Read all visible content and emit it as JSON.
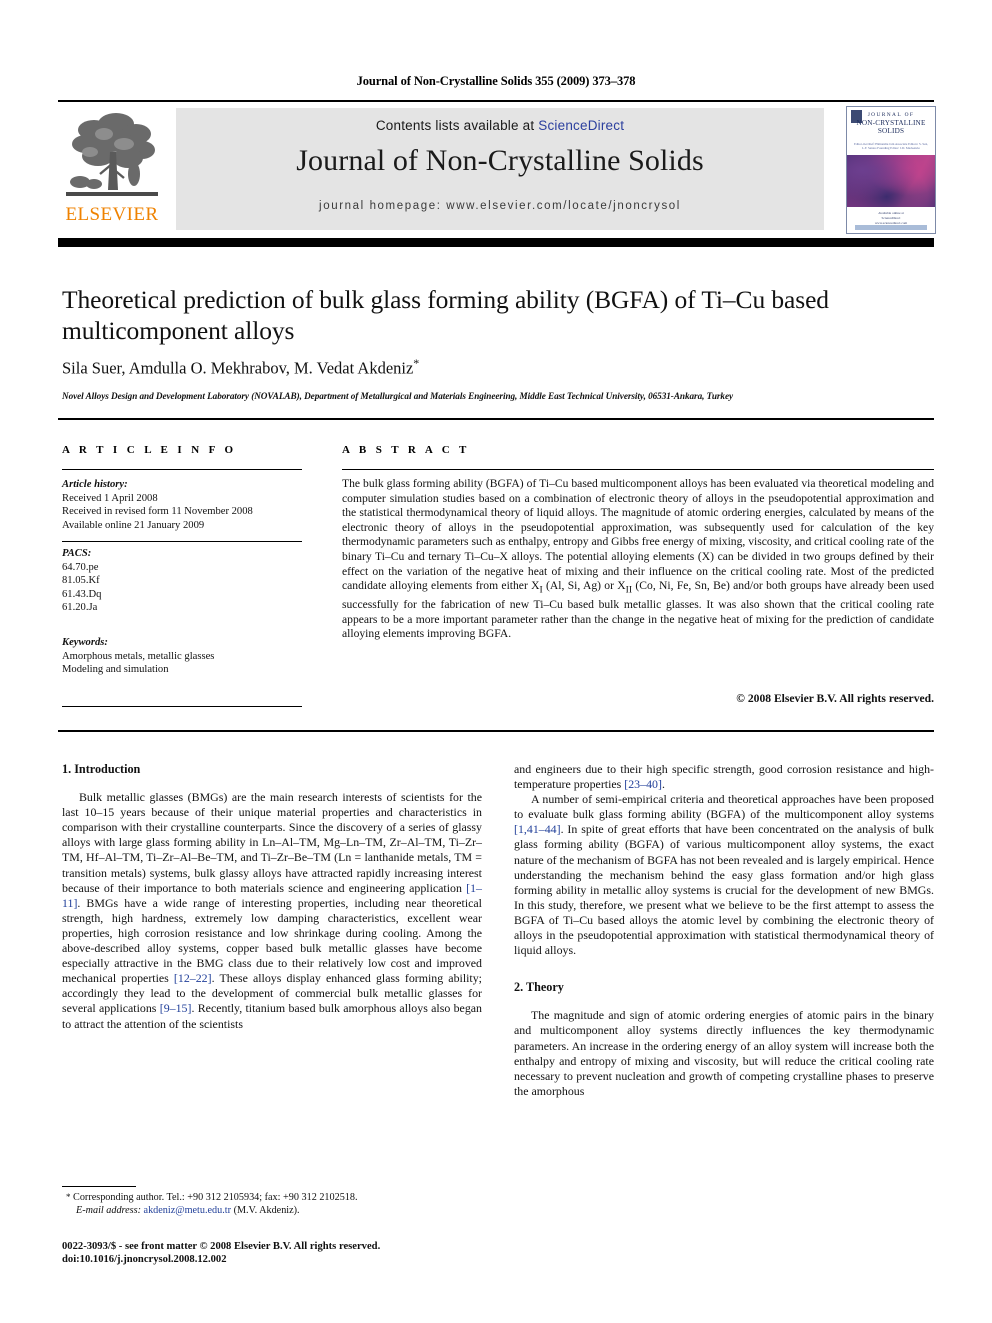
{
  "running_head": "Journal of Non-Crystalline Solids 355 (2009) 373–378",
  "masthead": {
    "publisher_name": "ELSEVIER",
    "contents_prefix": "Contents lists available at ",
    "contents_link": "ScienceDirect",
    "journal_title": "Journal of Non-Crystalline Solids",
    "homepage": "journal homepage: www.elsevier.com/locate/jnoncrysol",
    "cover": {
      "line1": "JOURNAL OF",
      "line2": "NON-CRYSTALLINE SOLIDS",
      "subline": "Editor-in-Chief: Himanshu Jain   Associate Editors: S. Sen, L.F. Santos   Founding Editor: J.D. Mackenzie",
      "footer": "Available online at\nScienceDirect\nwww.sciencedirect.com"
    }
  },
  "article": {
    "title": "Theoretical prediction of bulk glass forming ability (BGFA) of Ti–Cu based multicomponent alloys",
    "authors": "Sila Suer, Amdulla O. Mekhrabov, M. Vedat Akdeniz",
    "corresponding_marker": "*",
    "affiliation": "Novel Alloys Design and Development Laboratory (NOVALAB), Department of Metallurgical and Materials Engineering, Middle East Technical University, 06531-Ankara, Turkey"
  },
  "article_info": {
    "heading": "A R T I C L E   I N F O",
    "history_label": "Article history:",
    "history": [
      "Received 1 April 2008",
      "Received in revised form 11 November 2008",
      "Available online 21 January 2009"
    ],
    "pacs_label": "PACS:",
    "pacs": [
      "64.70.pe",
      "81.05.Kf",
      "61.43.Dq",
      "61.20.Ja"
    ],
    "keywords_label": "Keywords:",
    "keywords": [
      "Amorphous metals, metallic glasses",
      "Modeling and simulation"
    ]
  },
  "abstract": {
    "heading": "A B S T R A C T",
    "text": "The bulk glass forming ability (BGFA) of Ti–Cu based multicomponent alloys has been evaluated via theoretical modeling and computer simulation studies based on a combination of electronic theory of alloys in the pseudopotential approximation and the statistical thermodynamical theory of liquid alloys. The magnitude of atomic ordering energies, calculated by means of the electronic theory of alloys in the pseudopotential approximation, was subsequently used for calculation of the key thermodynamic parameters such as enthalpy, entropy and Gibbs free energy of mixing, viscosity, and critical cooling rate of the binary Ti–Cu and ternary Ti–Cu–X alloys. The potential alloying elements (X) can be divided in two groups defined by their effect on the variation of the negative heat of mixing and their influence on the critical cooling rate. Most of the predicted candidate alloying elements from either XI (Al, Si, Ag) or XII (Co, Ni, Fe, Sn, Be) and/or both groups have already been used successfully for the fabrication of new Ti–Cu based bulk metallic glasses. It was also shown that the critical cooling rate appears to be a more important parameter rather than the change in the negative heat of mixing for the prediction of candidate alloying elements improving BGFA.",
    "copyright": "© 2008 Elsevier B.V. All rights reserved."
  },
  "body": {
    "section1_heading": "1. Introduction",
    "section1_para1": "Bulk metallic glasses (BMGs) are the main research interests of scientists for the last 10–15 years because of their unique material properties and characteristics in comparison with their crystalline counterparts. Since the discovery of a series of glassy alloys with large glass forming ability in Ln–Al–TM, Mg–Ln–TM, Zr–Al–TM, Ti–Zr–TM, Hf–Al–TM, Ti–Zr–Al–Be–TM, and Ti–Zr–Be–TM (Ln = lanthanide metals, TM = transition metals) systems, bulk glassy alloys have attracted rapidly increasing interest because of their importance to both materials science and engineering application [1–11]. BMGs have a wide range of interesting properties, including near theoretical strength, high hardness, extremely low damping characteristics, excellent wear properties, high corrosion resistance and low shrinkage during cooling. Among the above-described alloy systems, copper based bulk metallic glasses have become especially attractive in the BMG class due to their relatively low cost and improved mechanical properties [12–22]. These alloys display enhanced glass forming ability; accordingly they lead to the development of commercial bulk metallic glasses for several applications [9–15]. Recently, titanium based bulk amorphous alloys also began to attract the attention of the scientists",
    "section1_para1_cont": "and engineers due to their high specific strength, good corrosion resistance and high-temperature properties [23–40].",
    "section1_para2": "A number of semi-empirical criteria and theoretical approaches have been proposed to evaluate bulk glass forming ability (BGFA) of the multicomponent alloy systems [1,41–44]. In spite of great efforts that have been concentrated on the analysis of bulk glass forming ability (BGFA) of various multicomponent alloy systems, the exact nature of the mechanism of BGFA has not been revealed and is largely empirical. Hence understanding the mechanism behind the easy glass formation and/or high glass forming ability in metallic alloy systems is crucial for the development of new BMGs. In this study, therefore, we present what we believe to be the first attempt to assess the BGFA of Ti–Cu based alloys the atomic level by combining the electronic theory of alloys in the pseudopotential approximation with statistical thermodynamical theory of liquid alloys.",
    "section2_heading": "2. Theory",
    "section2_para1": "The magnitude and sign of atomic ordering energies of atomic pairs in the binary and multicomponent alloy systems directly influences the key thermodynamic parameters. An increase in the ordering energy of an alloy system will increase both the enthalpy and entropy of mixing and viscosity, but will reduce the critical cooling rate necessary to prevent nucleation and growth of competing crystalline phases to preserve the amorphous"
  },
  "footnote": {
    "marker": "*",
    "corresponding": "Corresponding author. Tel.: +90 312 2105934; fax: +90 312 2102518.",
    "email_label": "E-mail address:",
    "email": "akdeniz@metu.edu.tr",
    "email_owner": "(M.V. Akdeniz).",
    "issn_line": "0022-3093/$ - see front matter © 2008 Elsevier B.V. All rights reserved.",
    "doi_line": "doi:10.1016/j.jnoncrysol.2008.12.002"
  },
  "colors": {
    "link": "#22409a",
    "elsevier_orange": "#ef8200",
    "band_gray": "#e4e4e4"
  }
}
